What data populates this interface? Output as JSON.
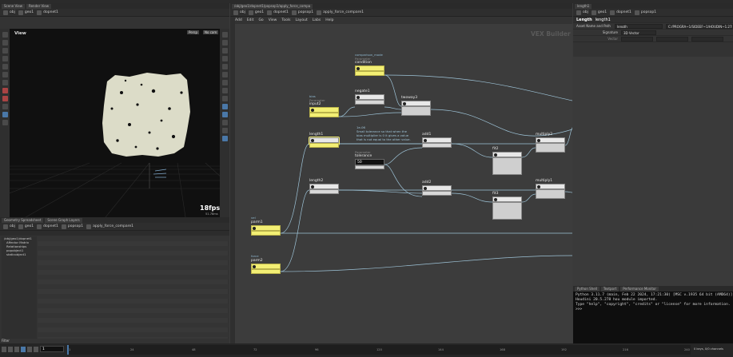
{
  "menubar": {
    "tabs": [
      "Scene View",
      "Render View"
    ]
  },
  "left": {
    "path": [
      "obj",
      "geo1",
      "dopnet1"
    ],
    "view_label": "View",
    "persp_label": "Persp",
    "cam_label": "No cam",
    "fps": "18fps",
    "time_ms": "51.78ms"
  },
  "spreadsheet": {
    "tabs": [
      "Geometry Spreadsheet",
      "Scene Graph Layers"
    ],
    "path": [
      "obj",
      "geo1",
      "dopnet1",
      "popsop1",
      "apply_force_compare1"
    ],
    "tree": [
      "/obj/geo1/dopnet1",
      "Affector Matrix",
      "Relationships",
      "popobject1",
      "staticobject1"
    ],
    "filter_label": "Filter"
  },
  "center": {
    "path_tab": "/obj/geo1/dopnet1/popsop1/apply_force_compa",
    "path": [
      "obj",
      "geo1",
      "dopnet1",
      "popsop1",
      "apply_force_compare1"
    ],
    "menu": [
      "Add",
      "Edit",
      "Go",
      "View",
      "Tools",
      "Layout",
      "Labs",
      "Help"
    ],
    "watermark": "VEX Builder",
    "nodes": {
      "comparison_mode": "comparison_mode",
      "param_sub": "Parameter",
      "condition": "condition",
      "bias": "bias",
      "input2": "input2",
      "negate1": "negate1",
      "twoway3": "twoway3",
      "length1": "length1",
      "tolerance": "tolerance",
      "tolerance_value": "50",
      "add1": "add1",
      "fit2": "fit2",
      "multiply2": "multiply2",
      "length2": "length2",
      "add2": "add2",
      "fit3": "fit3",
      "multiply1": "multiply1",
      "vel": "vel",
      "parm1": "parm1",
      "force": "force",
      "parm2": "parm2"
    },
    "sticky": "1e-06\nSmall tolerance so that when the\nbias multiplier is 0 it gives a value\nthat is not equal to the other value."
  },
  "right": {
    "tabs": [
      "length1"
    ],
    "path": [
      "obj",
      "geo1",
      "dopnet1",
      "popsop1",
      "apply_force_compare1"
    ],
    "node_type": "Length",
    "node_name": "length1",
    "asset_label": "Asset Name and Path",
    "asset_value": "length",
    "asset_path": "C:/PROGRA~1/SIDEEF~1/HOUDIN~1.278/ho",
    "signature_label": "Signature",
    "signature_value": "3D Vector",
    "vector_label": "Vector"
  },
  "console": {
    "tabs": [
      "Python Shell",
      "Textport",
      "Performance Monitor"
    ],
    "lines": [
      "Python 3.11.7 (main, Feb 22 2024, 17:21:30) [MSC v.1935 64 bit (AMD64)]",
      "Houdini 20.5.278 hou module imported.",
      "Type \"help\", \"copyright\", \"credits\" or \"license\" for more information.",
      ">>>"
    ]
  },
  "timeline": {
    "frame": "1",
    "ticks": [
      "1",
      "24",
      "48",
      "72",
      "96",
      "120",
      "144",
      "168",
      "192",
      "216",
      "240"
    ],
    "status": "0 keys, 0/0 channels"
  },
  "colors": {
    "node_yellow": "#f3ef74",
    "wire": "#9ec4d8",
    "accent_blue": "#4a78a8"
  }
}
